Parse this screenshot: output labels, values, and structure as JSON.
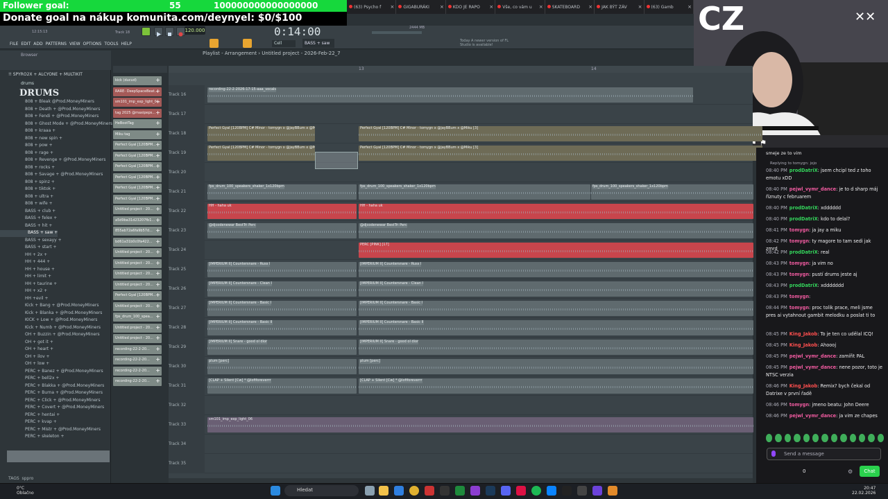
{
  "overlay": {
    "follower_goal_label": "Follower goal:",
    "follower_goal_value": "55",
    "follower_goal_extra": "100000000000000000",
    "donate_text": "Donate goal na nákup komunita.com/deynyel: $0/$100",
    "cam_text": "CZ"
  },
  "browser_tabs": [
    "(63) Psycho f",
    "GIGABURÁKI",
    "KDO JE RAPO",
    "Vše, co vám u",
    "SKATEBOARD",
    "JAK BÝT ZÁV",
    "(63) Gamb"
  ],
  "fl": {
    "menu": [
      "FILE",
      "EDIT",
      "ADD",
      "PATTERNS",
      "VIEW",
      "OPTIONS",
      "TOOLS",
      "HELP"
    ],
    "time": "0:14:00",
    "tempo": "120.000",
    "clock_small": "12:15:13",
    "track_label": "Track 18",
    "cpu": "2444 MB",
    "pattern_selector": "BASS + saw",
    "news": "Today  A newer version of FL Studio is available!",
    "snap": "Cell"
  },
  "playlist": {
    "title": "Playlist - Arrangement › Untitled project - 2026-Feb-22_7",
    "bars": [
      "13",
      "14"
    ],
    "tracks": [
      {
        "label": "Track 16",
        "clips": [
          {
            "name": "recording-22-2-2026-17-15-aaa_vocals",
            "color": "grey",
            "start": 0,
            "width": 700
          }
        ]
      },
      {
        "label": "Track 17",
        "clips": []
      },
      {
        "label": "Track 18",
        "clips": [
          {
            "name": "Perfect Gyal [120BPM] C# Minor - tomygn x @jayBBum x @Miku [3]",
            "color": "olive",
            "start": 0,
            "width": 155
          },
          {
            "name": "Perfect Gyal [120BPM] C# Minor - tomygn x @jayBBum x @Miku [3]",
            "color": "olive",
            "start": 218,
            "width": 582
          }
        ]
      },
      {
        "label": "Track 19",
        "clips": [
          {
            "name": "Perfect Gyal [120BPM] C# Minor - tomygn x @jayBBum x @Miku [3]",
            "color": "olive",
            "start": 0,
            "width": 155
          },
          {
            "name": "Perfect Gyal [120BPM] C# Minor - tomygn x @jayBBum x @Miku [3]",
            "color": "olive",
            "start": 218,
            "width": 582
          }
        ]
      },
      {
        "label": "Track 20",
        "clips": []
      },
      {
        "label": "Track 21",
        "clips": [
          {
            "name": "fps_drum_100_speakers_shaker_1x120bpm",
            "color": "grey",
            "start": 0,
            "width": 215
          },
          {
            "name": "fps_drum_100_speakers_shaker_1x120bpm",
            "color": "grey",
            "start": 218,
            "width": 334
          },
          {
            "name": "fps_drum_100_speakers_shaker_1x120bpm",
            "color": "grey",
            "start": 553,
            "width": 234
          }
        ]
      },
      {
        "label": "Track 22",
        "clips": [
          {
            "name": "HH - haha uk",
            "color": "red",
            "start": 0,
            "width": 215
          },
          {
            "name": "HH - haha uk",
            "color": "red",
            "start": 218,
            "width": 569
          }
        ]
      },
      {
        "label": "Track 23",
        "clips": [
          {
            "name": "@djcodenewar BestTri Perc",
            "color": "grey",
            "start": 0,
            "width": 215
          },
          {
            "name": "@djcodenewar BestTri Perc",
            "color": "grey",
            "start": 218,
            "width": 569
          }
        ]
      },
      {
        "label": "Track 24",
        "clips": [
          {
            "name": "PERC [PINK] [17]",
            "color": "red",
            "start": 218,
            "width": 569
          }
        ]
      },
      {
        "label": "Track 25",
        "clips": [
          {
            "name": "[IMPERIUM II] Countersnare - Russ I",
            "color": "grey",
            "start": 0,
            "width": 215
          },
          {
            "name": "[IMPERIUM II] Countersnare - Russ I",
            "color": "grey",
            "start": 218,
            "width": 569
          }
        ]
      },
      {
        "label": "Track 26",
        "clips": [
          {
            "name": "[IMPERIUM II] Countersnare - Clean I",
            "color": "grey",
            "start": 0,
            "width": 215
          },
          {
            "name": "[IMPERIUM II] Countersnare - Clean I",
            "color": "grey",
            "start": 218,
            "width": 569
          }
        ]
      },
      {
        "label": "Track 27",
        "clips": [
          {
            "name": "[IMPERIUM II] Countersnare - Basic I",
            "color": "grey",
            "start": 0,
            "width": 215
          },
          {
            "name": "[IMPERIUM II] Countersnare - Basic I",
            "color": "grey",
            "start": 218,
            "width": 569
          }
        ]
      },
      {
        "label": "Track 28",
        "clips": [
          {
            "name": "[IMPERIUM II] Countersnare - Basic II",
            "color": "grey",
            "start": 0,
            "width": 215
          },
          {
            "name": "[IMPERIUM II] Countersnare - Basic II",
            "color": "grey",
            "start": 218,
            "width": 569
          }
        ]
      },
      {
        "label": "Track 29",
        "clips": [
          {
            "name": "[IMPERIUM II] Snare - good ol dior",
            "color": "grey",
            "start": 0,
            "width": 215
          },
          {
            "name": "[IMPERIUM II] Snare - good ol dior",
            "color": "grey",
            "start": 218,
            "width": 569
          }
        ]
      },
      {
        "label": "Track 30",
        "clips": [
          {
            "name": "plum [perc]",
            "color": "grey",
            "start": 0,
            "width": 215
          },
          {
            "name": "plum [perc]",
            "color": "grey",
            "start": 218,
            "width": 569
          }
        ]
      },
      {
        "label": "Track 31",
        "clips": [
          {
            "name": "[CLAP + Silent [Cw] * @lofiforeverrr",
            "color": "grey",
            "start": 0,
            "width": 215
          },
          {
            "name": "[CLAP + Silent [Cw] * @lofiforeverrr",
            "color": "grey",
            "start": 218,
            "width": 569
          }
        ]
      },
      {
        "label": "Track 32",
        "clips": []
      },
      {
        "label": "Track 33",
        "clips": [
          {
            "name": "sm101_imp_exp_light_06",
            "color": "purple",
            "start": 0,
            "width": 787
          }
        ]
      },
      {
        "label": "Track 34",
        "clips": []
      },
      {
        "label": "Track 35",
        "clips": []
      }
    ]
  },
  "patterns": [
    "kick (ducud)",
    "RARE- DeepSpaceBeat...",
    "sm101_imp_exp_light_0...",
    "tag 2025 @maxipeps...",
    "HeBootTag",
    "Miku tag",
    "Perfect Gyal [120BPM...",
    "Perfect Gyal [120BPM...",
    "Perfect Gyal [120BPM...",
    "Perfect Gyal [120BPM...",
    "Perfect Gyal [120BPM...",
    "Perfect Gyal [120BPM...",
    "Untitled project - 20...",
    "a5d9ba31d23207fb1...",
    "855ab72a6fa9b57d...",
    "bd61a31b0c0fa422...",
    "Untitled project - 20...",
    "Untitled project - 20...",
    "Untitled project - 20...",
    "Untitled project - 20...",
    "Perfect Gyal [120BPM...",
    "Untitled project - 20...",
    "fps_drum_100_spea...",
    "Untitled project - 20...",
    "Untitled project - 20...",
    "recording-22-2-20...",
    "recording-22-2-20...",
    "recording-22-2-20...",
    "recording-22-2-20..."
  ],
  "browser": {
    "title": "Browser",
    "pack": "!! SPYRO2X + ALCYONE + MULTIKIT",
    "folder": "drums",
    "logo": "DRUMS",
    "items": [
      "808 + Bleak @Prod.MoneyMiners",
      "808 + Death + @Prod.MoneyMiners",
      "808 + Fendi + @Prod.MoneyMiners",
      "808 + Ghost Mode + @Prod.MoneyMiners",
      "808 + kraaa +",
      "808 + new spin +",
      "808 + pow +",
      "808 + rage +",
      "808 + Revenge + @Prod.MoneyMiners",
      "808 + rocks +",
      "808 + Savage + @Prod.MoneyMiners",
      "808 + spinz +",
      "808 + tiktok +",
      "808 + ultra +",
      "808 + wife +",
      "BASS + club +",
      "BASS + felex +",
      "BASS + hit +",
      "BASS + saw +",
      "BASS + sexayy +",
      "BASS + start +",
      "HH + 2x +",
      "HH + 444 +",
      "HH + house +",
      "HH + limit +",
      "HH + taurine +",
      "HH + x2 +",
      "HH +evil +",
      "Kick + Bang + @Prod.MoneyMiners",
      "Kick + Blanka + @Prod.MoneyMiners",
      "KICK + Low + @Prod.MoneyMiners",
      "Kick + Numb + @Prod.MoneyMiners",
      "OH + Buzzin + @Prod.MoneyMiners",
      "OH + got it +",
      "OH + heart +",
      "OH + ilov +",
      "OH + low +",
      "PERC + Banez + @Prod.MoneyMiners",
      "PERC + bell2x +",
      "PERC + Blakka + @Prod.MoneyMiners",
      "PERC + Burna + @Prod.MoneyMiners",
      "PERC + Click + @Prod.MoneyMiners",
      "PERC + Covert + @Prod.MoneyMiners",
      "PERC + hentai +",
      "PERC + kvap +",
      "PERC + Mistr + @Prod.MoneyMiners",
      "PERC + skeleton +"
    ],
    "tags_label": "TAGS",
    "tags_value": "sppro"
  },
  "chat": {
    "top_text": "smeje ze to vim",
    "reply_text": "Replying to tomygn: jojo",
    "messages": [
      {
        "time": "08:40 PM",
        "user": "prodDatriX",
        "color": "g",
        "text": "jsem chcipl ted z toho emotu xDD"
      },
      {
        "time": "08:40 PM",
        "user": "pejwl_vymr_dance",
        "color": "p",
        "text": "je to d sharp máj říznuty c februarem"
      },
      {
        "time": "08:40 PM",
        "user": "prodDatriX",
        "color": "g",
        "text": "xdddddd"
      },
      {
        "time": "08:40 PM",
        "user": "prodDatriX",
        "color": "g",
        "text": "kdo to delal?"
      },
      {
        "time": "08:41 PM",
        "user": "tomygn",
        "color": "p",
        "text": "ja jay a miku"
      },
      {
        "time": "08:42 PM",
        "user": "tomygn",
        "color": "p",
        "text": "ty magore to tam sedi jak zmrd"
      },
      {
        "time": "08:42 PM",
        "user": "prodDatriX",
        "color": "g",
        "text": "real"
      },
      {
        "time": "08:43 PM",
        "user": "tomygn",
        "color": "p",
        "text": "ja vim no"
      },
      {
        "time": "08:43 PM",
        "user": "tomygn",
        "color": "p",
        "text": "pustí drums jeste aj"
      },
      {
        "time": "08:43 PM",
        "user": "prodDatriX",
        "color": "g",
        "text": "xddddddd"
      },
      {
        "time": "08:43 PM",
        "user": "tomygn",
        "color": "p",
        "text": ""
      },
      {
        "time": "08:44 PM",
        "user": "tomygn",
        "color": "p",
        "text": "proc tolik prace, meli jsme pres ai vytahnout gambit melodku a poslat ti to"
      },
      {
        "time": "08:45 PM",
        "user": "King_Jakob",
        "color": "r",
        "text": "To je ten co udělal ICQ!"
      },
      {
        "time": "08:45 PM",
        "user": "King_Jakob",
        "color": "r",
        "text": "Ahoooj"
      },
      {
        "time": "08:45 PM",
        "user": "pejwl_vymr_dance",
        "color": "p",
        "text": "zamířit PAL"
      },
      {
        "time": "08:45 PM",
        "user": "pejwl_vymr_dance",
        "color": "p",
        "text": "nene pozor, toto je NTSC verzia"
      },
      {
        "time": "08:46 PM",
        "user": "King_Jakob",
        "color": "r",
        "text": "Remix? bych čekal od Datrixe v první řadě"
      },
      {
        "time": "08:46 PM",
        "user": "tomygn",
        "color": "p",
        "text": "jmeno beatu: John Deere"
      },
      {
        "time": "08:46 PM",
        "user": "pejwl_vymr_dance",
        "color": "p",
        "text": "ja vim ze chapes"
      }
    ],
    "input_placeholder": "Send a message",
    "chat_button": "Chat",
    "points": "0"
  },
  "taskbar": {
    "weather_temp": "0°C",
    "weather_desc": "Oblačno",
    "search": "Hledat",
    "time": "20:47",
    "date": "22.02.2026"
  }
}
